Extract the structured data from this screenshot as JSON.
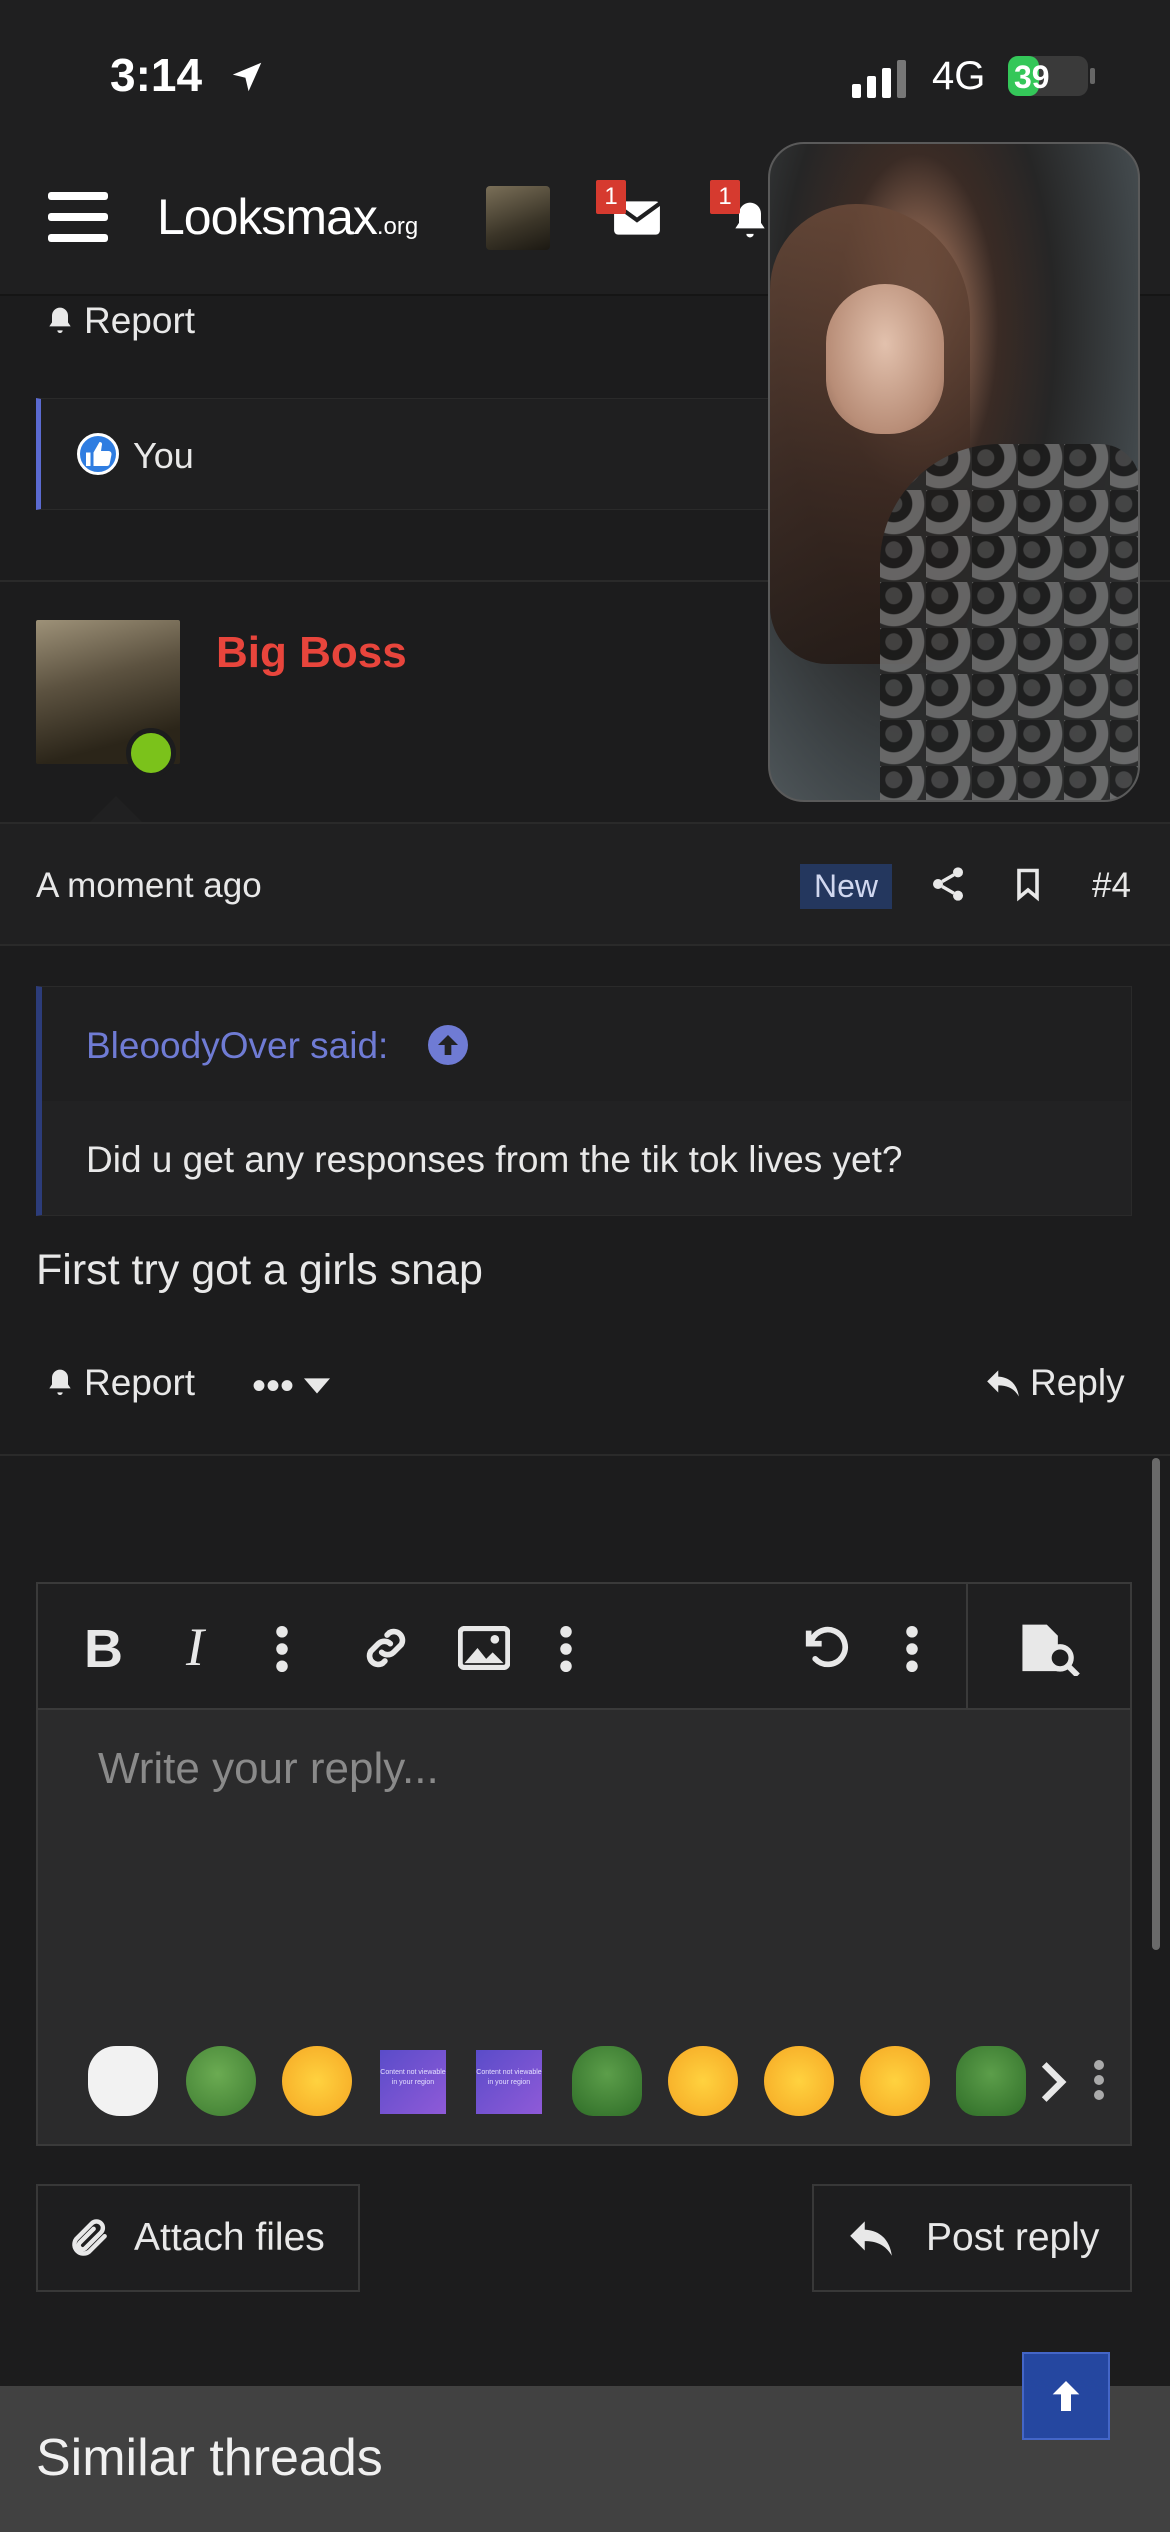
{
  "status_bar": {
    "time": "3:14",
    "network": "4G",
    "battery": "39",
    "battery_level": 0.39
  },
  "header": {
    "logo_main": "Looksmax",
    "logo_suffix": ".org",
    "messages_badge": "1",
    "alerts_badge": "1"
  },
  "previous_post": {
    "report_label": "Report",
    "reaction_text": "You"
  },
  "post": {
    "username": "Big Boss",
    "time": "A moment ago",
    "new_label": "New",
    "number": "#4",
    "quote_author": "BleoodyOver said:",
    "quote_text": "Did u get any responses from the tik tok lives yet?",
    "body": "First try got a girls snap",
    "report_label": "Report",
    "more_label": "•••",
    "reply_label": "Reply"
  },
  "editor": {
    "placeholder": "Write your reply...",
    "emoji_box_text": "Content not viewable in your region"
  },
  "buttons": {
    "attach_label": "Attach files",
    "post_reply_label": "Post reply"
  },
  "similar": {
    "title": "Similar threads"
  },
  "colors": {
    "username": "#e8453c",
    "accent_blue": "#6f7bd4",
    "online": "#7bc21b",
    "battery_green": "#34c759"
  }
}
